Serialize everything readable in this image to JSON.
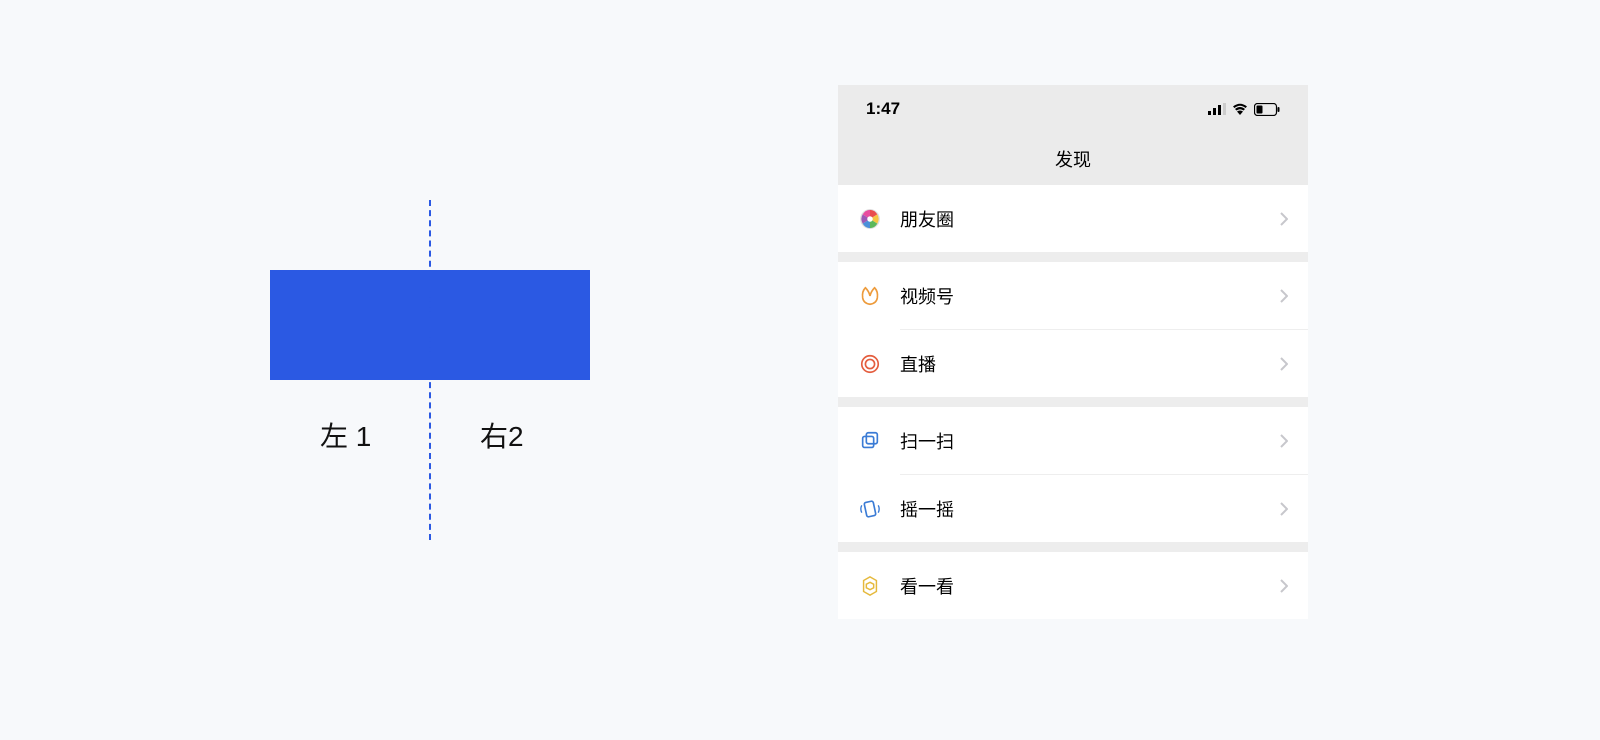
{
  "diagram": {
    "left_label": "左 1",
    "right_label": "右2"
  },
  "phone": {
    "status_bar": {
      "time": "1:47"
    },
    "nav_title": "发现",
    "menu_items": [
      {
        "icon": "moments-icon",
        "label": "朋友圈"
      },
      {
        "icon": "channels-icon",
        "label": "视频号"
      },
      {
        "icon": "live-icon",
        "label": "直播"
      },
      {
        "icon": "scan-icon",
        "label": "扫一扫"
      },
      {
        "icon": "shake-icon",
        "label": "摇一摇"
      },
      {
        "icon": "look-icon",
        "label": "看一看"
      }
    ]
  }
}
